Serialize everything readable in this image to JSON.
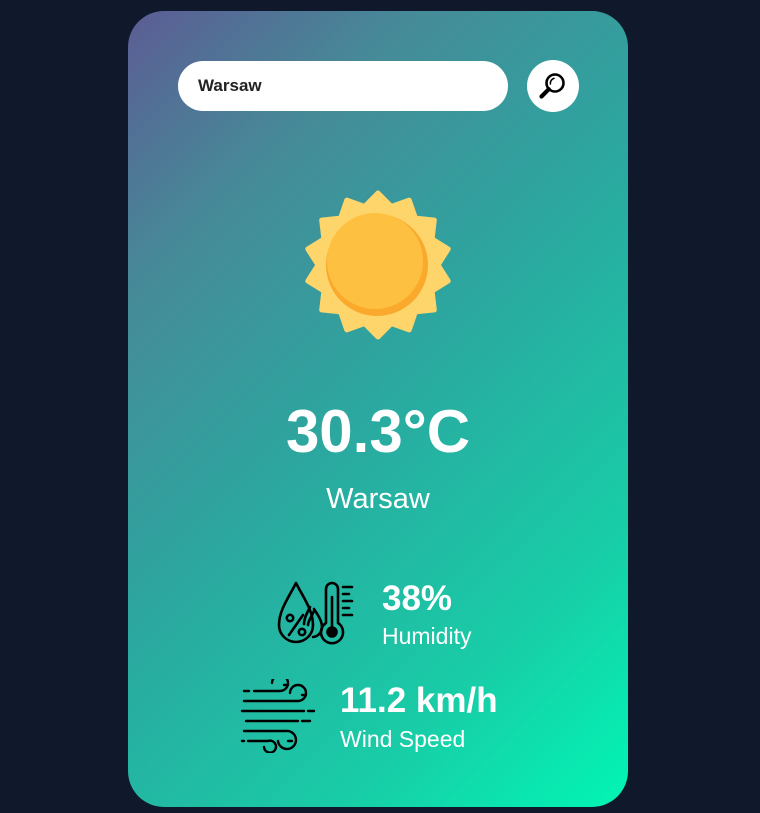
{
  "search": {
    "value": "Warsaw",
    "button_icon": "search-icon"
  },
  "weather": {
    "icon": "sun-icon",
    "temperature": "30.3°C",
    "city": "Warsaw"
  },
  "details": {
    "humidity": {
      "icon": "humidity-icon",
      "value": "38%",
      "label": "Humidity"
    },
    "wind": {
      "icon": "wind-icon",
      "value": "11.2 km/h",
      "label": "Wind Speed"
    }
  },
  "colors": {
    "page_background": "#10192b",
    "gradient_start": "#5c5c94",
    "gradient_end": "#01f6b4",
    "sun_outer": "#fdd56b",
    "sun_inner": "#fec040",
    "sun_shadow": "#fba92c",
    "text": "#ffffff"
  }
}
